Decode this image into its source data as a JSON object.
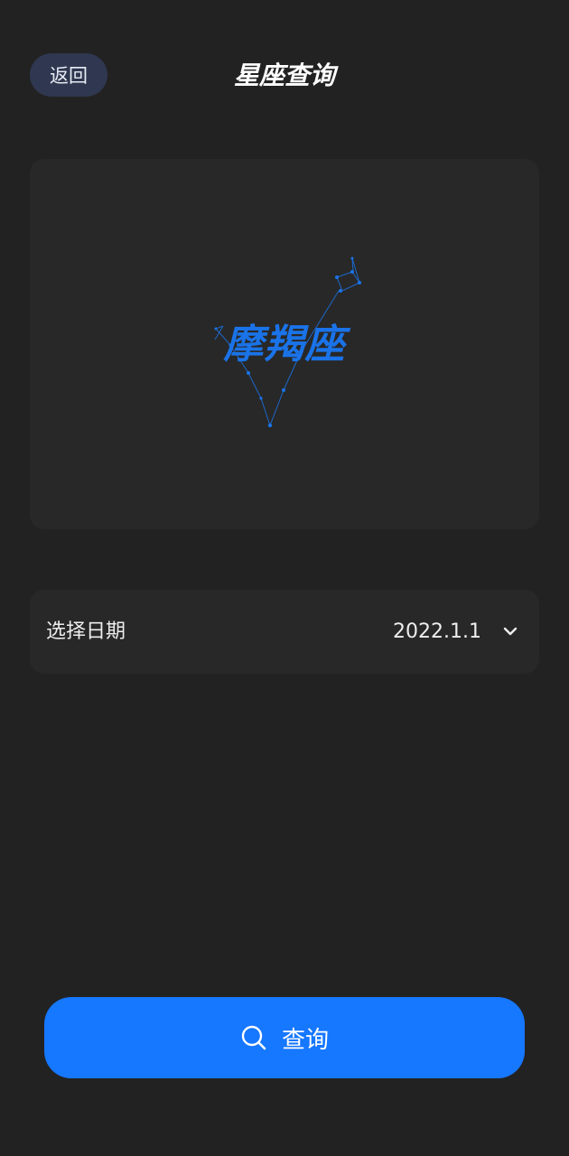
{
  "header": {
    "back_label": "返回",
    "title": "星座查询"
  },
  "hero": {
    "sign_name": "摩羯座",
    "accent_color": "#1a73e8"
  },
  "date_picker": {
    "label": "选择日期",
    "value": "2022.1.1",
    "icon": "chevron-down-icon"
  },
  "query_button": {
    "label": "查询",
    "icon": "search-icon",
    "color": "#1677ff"
  }
}
